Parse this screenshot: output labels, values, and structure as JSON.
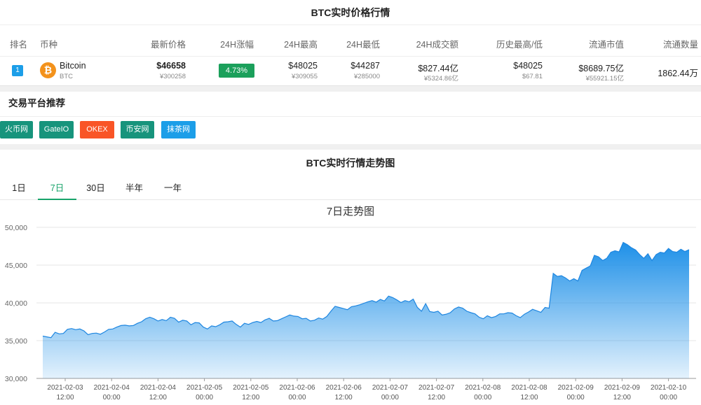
{
  "price_section": {
    "title": "BTC实时价格行情",
    "headers": {
      "rank": "排名",
      "coin": "币种",
      "price": "最新价格",
      "change": "24H涨幅",
      "high": "24H最高",
      "low": "24H最低",
      "volume": "24H成交额",
      "ath_atl": "历史最高/低",
      "market_cap": "流通市值",
      "supply": "流通数量"
    },
    "row": {
      "rank": "1",
      "coin_name": "Bitcoin",
      "coin_symbol": "BTC",
      "icon": "bitcoin-icon",
      "icon_glyph": "₿",
      "price_usd": "$46658",
      "price_cny": "¥300258",
      "change": "4.73%",
      "high_usd": "$48025",
      "high_cny": "¥309055",
      "low_usd": "$44287",
      "low_cny": "¥285000",
      "volume_usd": "$827.44亿",
      "volume_cny": "¥5324.86亿",
      "ath": "$48025",
      "atl": "$67.81",
      "mcap_usd": "$8689.75亿",
      "mcap_cny": "¥55921.15亿",
      "supply": "1862.44万"
    }
  },
  "exchanges": {
    "title": "交易平台推荐",
    "items": [
      {
        "label": "火币网",
        "color": "#17947c"
      },
      {
        "label": "GateIO",
        "color": "#17947c"
      },
      {
        "label": "OKEX",
        "color": "#f95527"
      },
      {
        "label": "币安网",
        "color": "#17947c"
      },
      {
        "label": "抹茶网",
        "color": "#1c9ee8"
      }
    ]
  },
  "chart_section": {
    "title": "BTC实时行情走势图",
    "tabs": [
      "1日",
      "7日",
      "30日",
      "半年",
      "一年"
    ],
    "active_tab": 1
  },
  "chart_data": {
    "type": "area",
    "title": "7日走势图",
    "ylim": [
      30000,
      50000
    ],
    "yticks": [
      "50,000",
      "45,000",
      "40,000",
      "35,000",
      "30,000"
    ],
    "x_tick_labels": [
      [
        "2021-02-03",
        "12:00"
      ],
      [
        "2021-02-04",
        "00:00"
      ],
      [
        "2021-02-04",
        "12:00"
      ],
      [
        "2021-02-05",
        "00:00"
      ],
      [
        "2021-02-05",
        "12:00"
      ],
      [
        "2021-02-06",
        "00:00"
      ],
      [
        "2021-02-06",
        "12:00"
      ],
      [
        "2021-02-07",
        "00:00"
      ],
      [
        "2021-02-07",
        "12:00"
      ],
      [
        "2021-02-08",
        "00:00"
      ],
      [
        "2021-02-08",
        "12:00"
      ],
      [
        "2021-02-09",
        "00:00"
      ],
      [
        "2021-02-09",
        "12:00"
      ],
      [
        "2021-02-10",
        "00:00"
      ]
    ],
    "color": "#1e90e8",
    "values": [
      35600,
      35500,
      35400,
      36100,
      35900,
      35950,
      36500,
      36600,
      36450,
      36550,
      36300,
      35800,
      35950,
      36000,
      35850,
      36150,
      36500,
      36550,
      36800,
      37000,
      37050,
      36950,
      37000,
      37300,
      37500,
      37900,
      38100,
      37900,
      37600,
      37800,
      37650,
      38100,
      37950,
      37450,
      37700,
      37600,
      37100,
      37400,
      37350,
      36800,
      36550,
      36950,
      36850,
      37100,
      37450,
      37500,
      37600,
      37150,
      36800,
      37300,
      37150,
      37400,
      37550,
      37400,
      37750,
      37950,
      37600,
      37650,
      37900,
      38150,
      38400,
      38250,
      38200,
      37900,
      37950,
      37600,
      37700,
      38000,
      37850,
      38200,
      38900,
      39550,
      39400,
      39250,
      39100,
      39500,
      39600,
      39750,
      39950,
      40150,
      40300,
      40100,
      40450,
      40250,
      40900,
      40700,
      40400,
      40050,
      40300,
      40150,
      40500,
      39400,
      38900,
      39900,
      38850,
      38750,
      38900,
      38400,
      38500,
      38700,
      39200,
      39450,
      39300,
      38900,
      38700,
      38550,
      38100,
      37900,
      38300,
      38050,
      38200,
      38550,
      38550,
      38700,
      38650,
      38300,
      38050,
      38500,
      38800,
      39150,
      38950,
      38750,
      39400,
      39300,
      43900,
      43500,
      43600,
      43300,
      42900,
      43200,
      42900,
      44300,
      44600,
      44900,
      46300,
      46100,
      45600,
      45900,
      46700,
      46900,
      46750,
      48000,
      47700,
      47300,
      47000,
      46400,
      45900,
      46500,
      45600,
      46400,
      46700,
      46600,
      47200,
      46800,
      46700,
      47100,
      46800,
      47050
    ]
  }
}
